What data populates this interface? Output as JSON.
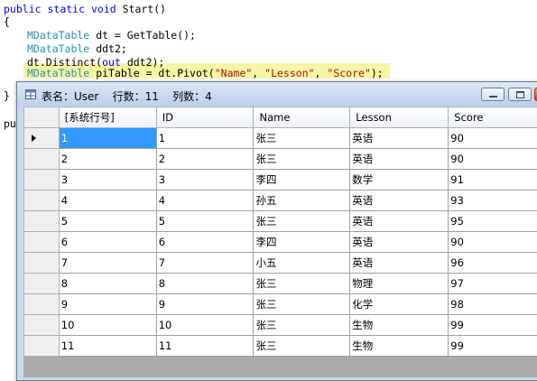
{
  "code": {
    "line1": {
      "kw1": "public",
      "kw2": "static",
      "kw3": "void",
      "rest": "Start()"
    },
    "line2": "{",
    "line3": {
      "type": "MDataTable",
      "rest": "dt = GetTable();"
    },
    "line4": {
      "type": "MDataTable",
      "rest": "ddt2;"
    },
    "line5": {
      "pre": "dt.Distinct(",
      "kw": "out",
      "post": "ddt2);"
    },
    "line6": {
      "type": "MDataTable",
      "pre": "piTable = dt.Pivot(",
      "s1": "\"Name\"",
      "s2": "\"Lesson\"",
      "s3": "\"Score\"",
      "post": ");"
    },
    "line7": "}",
    "line8": "pu"
  },
  "window": {
    "title": "表名：User    行数：11    列数：4"
  },
  "grid": {
    "columns": [
      "[系统行号]",
      "ID",
      "Name",
      "Lesson",
      "Score"
    ],
    "rows": [
      [
        "1",
        "1",
        "张三",
        "英语",
        "90"
      ],
      [
        "2",
        "2",
        "张三",
        "英语",
        "90"
      ],
      [
        "3",
        "3",
        "李四",
        "数学",
        "91"
      ],
      [
        "4",
        "4",
        "孙五",
        "英语",
        "93"
      ],
      [
        "5",
        "5",
        "张三",
        "英语",
        "95"
      ],
      [
        "6",
        "6",
        "李四",
        "英语",
        "90"
      ],
      [
        "7",
        "7",
        "小五",
        "英语",
        "96"
      ],
      [
        "8",
        "8",
        "张三",
        "物理",
        "97"
      ],
      [
        "9",
        "9",
        "张三",
        "化学",
        "98"
      ],
      [
        "10",
        "10",
        "张三",
        "生物",
        "99"
      ],
      [
        "11",
        "11",
        "张三",
        "生物",
        "99"
      ]
    ]
  },
  "colors": {
    "keyword": "#0000ff",
    "type": "#2b91af",
    "string": "#a31515",
    "highlight": "#f6f6a4",
    "selection": "#3399ff"
  }
}
